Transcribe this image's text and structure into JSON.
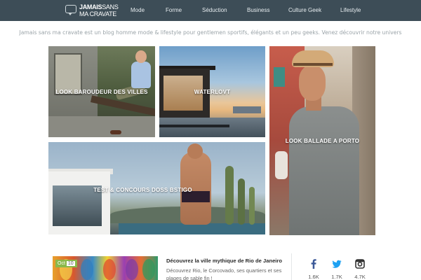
{
  "header": {
    "logo": {
      "line1_bold": "JAMAIS",
      "line1_rest": "SANS",
      "line2": "MA CRAVATE"
    },
    "nav": [
      {
        "label": "Mode"
      },
      {
        "label": "Forme"
      },
      {
        "label": "Séduction"
      },
      {
        "label": "Business"
      },
      {
        "label": "Culture Geek"
      },
      {
        "label": "Lifestyle"
      }
    ],
    "bg_color": "#3d4d57"
  },
  "tagline": "Jamais sans ma cravate est un blog homme mode & lifestyle pour gentlemen sportifs, élégants et un peu geeks. Venez découvrir notre univers",
  "featured": [
    {
      "label": "LOOK BAROUDEUR DES VILLES"
    },
    {
      "label": "WATERLOVT"
    },
    {
      "label": "LOOK BALLADE A PORTO"
    },
    {
      "label": "TEST & CONCOURS DOSS BSTIGO"
    }
  ],
  "latest_post": {
    "badge_month": "Oct",
    "badge_day": "10",
    "title": "Découvrez la ville mythique de Rio de Janeiro",
    "excerpt": "Découvrez Rio, le Corcovado, ses quartiers et ses plages de sable fin !",
    "badge_color": "#8ab84a"
  },
  "social": [
    {
      "icon": "facebook-icon",
      "count": "1.6K",
      "color": "#3b5998"
    },
    {
      "icon": "twitter-icon",
      "count": "1.7K",
      "color": "#1da1f2"
    },
    {
      "icon": "instagram-icon",
      "count": "4.7K",
      "color": "#333333"
    }
  ]
}
